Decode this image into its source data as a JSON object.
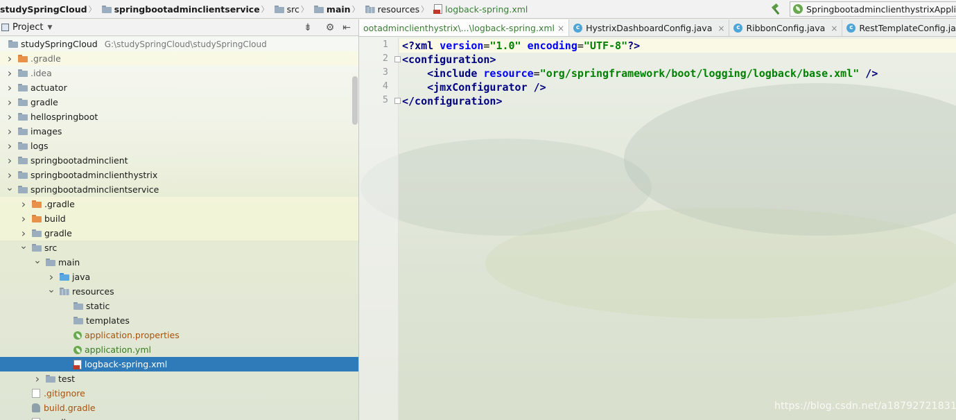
{
  "breadcrumb": [
    {
      "label": "studySpringCloud",
      "bold": true,
      "icon": "none"
    },
    {
      "label": "springbootadminclientservice",
      "bold": true,
      "icon": "folder-icon"
    },
    {
      "label": "src",
      "bold": false,
      "icon": "folder-icon"
    },
    {
      "label": "main",
      "bold": true,
      "icon": "folder-icon"
    },
    {
      "label": "resources",
      "bold": false,
      "icon": "resources-folder-icon"
    },
    {
      "label": "logback-spring.xml",
      "bold": false,
      "icon": "xml-file-icon"
    }
  ],
  "run_config": {
    "label": "SpringbootadminclienthystrixApplication"
  },
  "project_panel": {
    "title": "Project"
  },
  "tree": [
    {
      "label": "studySpringCloud",
      "path": "G:\\studySpringCloud\\studySpringCloud",
      "depth": 0,
      "arrow": "none",
      "icon": "module",
      "style": ""
    },
    {
      "label": ".gradle",
      "depth": 1,
      "arrow": "right",
      "icon": "folder-orange",
      "style": "gray"
    },
    {
      "label": ".idea",
      "depth": 1,
      "arrow": "right",
      "icon": "folder",
      "style": "gray"
    },
    {
      "label": "actuator",
      "depth": 1,
      "arrow": "right",
      "icon": "folder",
      "style": ""
    },
    {
      "label": "gradle",
      "depth": 1,
      "arrow": "right",
      "icon": "folder",
      "style": ""
    },
    {
      "label": "hellospringboot",
      "depth": 1,
      "arrow": "right",
      "icon": "folder",
      "style": ""
    },
    {
      "label": "images",
      "depth": 1,
      "arrow": "right",
      "icon": "folder",
      "style": ""
    },
    {
      "label": "logs",
      "depth": 1,
      "arrow": "right",
      "icon": "folder",
      "style": ""
    },
    {
      "label": "springbootadminclient",
      "depth": 1,
      "arrow": "right",
      "icon": "folder",
      "style": ""
    },
    {
      "label": "springbootadminclienthystrix",
      "depth": 1,
      "arrow": "right",
      "icon": "folder",
      "style": ""
    },
    {
      "label": "springbootadminclientservice",
      "depth": 1,
      "arrow": "down",
      "icon": "folder",
      "style": ""
    },
    {
      "label": ".gradle",
      "depth": 2,
      "arrow": "right",
      "icon": "folder-orange",
      "style": ""
    },
    {
      "label": "build",
      "depth": 2,
      "arrow": "right",
      "icon": "folder-orange",
      "style": ""
    },
    {
      "label": "gradle",
      "depth": 2,
      "arrow": "right",
      "icon": "folder",
      "style": ""
    },
    {
      "label": "src",
      "depth": 2,
      "arrow": "down",
      "icon": "folder",
      "style": ""
    },
    {
      "label": "main",
      "depth": 3,
      "arrow": "down",
      "icon": "folder",
      "style": ""
    },
    {
      "label": "java",
      "depth": 4,
      "arrow": "right",
      "icon": "folder-blue",
      "style": ""
    },
    {
      "label": "resources",
      "depth": 4,
      "arrow": "down",
      "icon": "folder-res",
      "style": ""
    },
    {
      "label": "static",
      "depth": 5,
      "arrow": "none",
      "icon": "folder",
      "style": ""
    },
    {
      "label": "templates",
      "depth": 5,
      "arrow": "none",
      "icon": "folder",
      "style": ""
    },
    {
      "label": "application.properties",
      "depth": 5,
      "arrow": "none",
      "icon": "spring",
      "style": "brown"
    },
    {
      "label": "application.yml",
      "depth": 5,
      "arrow": "none",
      "icon": "spring",
      "style": "green"
    },
    {
      "label": "logback-spring.xml",
      "depth": 5,
      "arrow": "none",
      "icon": "xml",
      "style": "",
      "selected": true
    },
    {
      "label": "test",
      "depth": 3,
      "arrow": "right",
      "icon": "folder",
      "style": ""
    },
    {
      "label": ".gitignore",
      "depth": 2,
      "arrow": "none",
      "icon": "git",
      "style": "brown"
    },
    {
      "label": "build.gradle",
      "depth": 2,
      "arrow": "none",
      "icon": "gradle",
      "style": "brown"
    },
    {
      "label": "gradlew",
      "depth": 2,
      "arrow": "none",
      "icon": "git",
      "style": ""
    }
  ],
  "tabs": [
    {
      "label": "ootadminclienthystrix\\...\\logback-spring.xml",
      "active": true,
      "icon": "none"
    },
    {
      "label": "HystrixDashboardConfig.java",
      "active": false,
      "icon": "class-icon"
    },
    {
      "label": "RibbonConfig.java",
      "active": false,
      "icon": "class-icon"
    },
    {
      "label": "RestTemplateConfig.java",
      "active": false,
      "icon": "class-icon"
    }
  ],
  "editor": {
    "line_numbers": [
      "1",
      "2",
      "3",
      "4",
      "5"
    ],
    "lines": [
      {
        "indent": "",
        "parts": [
          [
            "xmldecl",
            "<?"
          ],
          [
            "tag",
            "xml "
          ],
          [
            "attr",
            "version"
          ],
          [
            "punc",
            "="
          ],
          [
            "val",
            "\"1.0\" "
          ],
          [
            "attr",
            "encoding"
          ],
          [
            "punc",
            "="
          ],
          [
            "val",
            "\"UTF-8\""
          ],
          [
            "xmldecl",
            "?>"
          ]
        ]
      },
      {
        "indent": "",
        "parts": [
          [
            "tag",
            "<configuration"
          ],
          [
            "tag",
            ">"
          ]
        ]
      },
      {
        "indent": "    ",
        "parts": [
          [
            "tag",
            "<include "
          ],
          [
            "attr",
            "resource"
          ],
          [
            "punc",
            "="
          ],
          [
            "val",
            "\"org/springframework/boot/logging/logback/base.xml\" "
          ],
          [
            "tag",
            "/>"
          ]
        ]
      },
      {
        "indent": "    ",
        "parts": [
          [
            "tag",
            "<jmxConfigurator "
          ],
          [
            "tag",
            "/>"
          ]
        ]
      },
      {
        "indent": "",
        "parts": [
          [
            "tag",
            "</configuration>"
          ]
        ]
      }
    ]
  },
  "watermark": "https://blog.csdn.net/a18792721831"
}
